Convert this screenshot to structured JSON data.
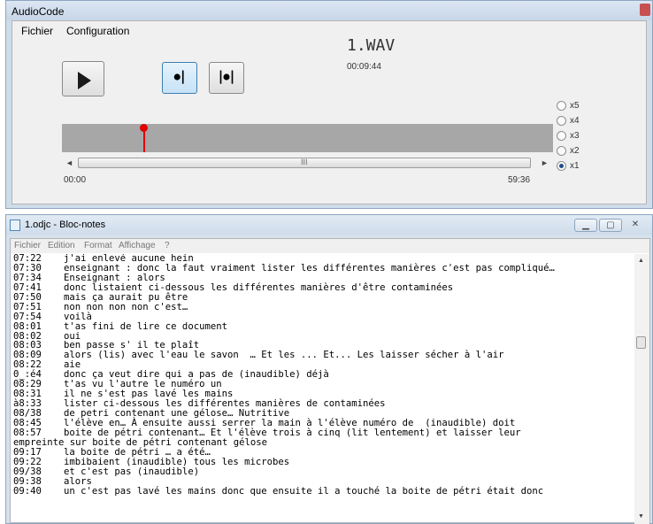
{
  "audio_app": {
    "title": "AudioCode",
    "menu": [
      "Fichier",
      "Configuration"
    ],
    "buttons": {
      "play_icon": "play-icon",
      "rewind_icon": "backstep-icon",
      "forward_icon": "forward-step-icon"
    },
    "filename": "1.WAV",
    "elapsed": "00:09:44",
    "timeline": {
      "start": "00:00",
      "end": "59:36",
      "position_fraction": 0.166,
      "marker_color": "#e00000"
    },
    "scroll_grip": "III",
    "speeds": [
      {
        "label": "x5",
        "selected": false
      },
      {
        "label": "x4",
        "selected": false
      },
      {
        "label": "x3",
        "selected": false
      },
      {
        "label": "x2",
        "selected": false
      },
      {
        "label": "x1",
        "selected": true
      }
    ]
  },
  "notepad": {
    "title": "1.odjc - Bloc-notes",
    "menu": [
      "Fichier",
      "Edition",
      "Format",
      "Affichage",
      "?"
    ],
    "lines": [
      {
        "ts": "07:22",
        "text": "j'ai enlevé aucune hein"
      },
      {
        "ts": "07:30",
        "text": "enseignant : donc la faut vraiment lister les différentes manières c'est pas compliqué…"
      },
      {
        "ts": "07:34",
        "text": "Enseignant : alors"
      },
      {
        "ts": "07:41",
        "text": "donc listaient ci-dessous les différentes manières d'être contaminées"
      },
      {
        "ts": "07:50",
        "text": "mais ça aurait pu être"
      },
      {
        "ts": "07:51",
        "text": "non non non non c'est…"
      },
      {
        "ts": "07:54",
        "text": "voilà"
      },
      {
        "ts": "08:01",
        "text": "t'as fini de lire ce document"
      },
      {
        "ts": "08:02",
        "text": "oui"
      },
      {
        "ts": "08:03",
        "text": "ben passe s' il te plaît"
      },
      {
        "ts": "08:09",
        "text": "alors (lis) avec l'eau le savon  … Et les ... Et... Les laisser sécher à l'air"
      },
      {
        "ts": "08:22",
        "text": "aie"
      },
      {
        "ts": "0_:é4",
        "text": "donc ça veut dire qui a pas de (inaudible) déjà"
      },
      {
        "ts": "08:29",
        "text": "t'as vu l'autre le numéro un"
      },
      {
        "ts": "08:31",
        "text": "il ne s'est pas lavé les mains"
      },
      {
        "ts": "à8:33",
        "text": "lister ci-dessous les différentes manières de contaminées"
      },
      {
        "ts": "08/38",
        "text": "de petri contenant une gélose… Nutritive"
      },
      {
        "ts": "08:45",
        "text": "l'élève en… À ensuite aussi serrer la main à l'élève numéro de  (inaudible) doit"
      },
      {
        "ts": "08:57",
        "text": "boite de pétri contenant… Et l'élève trois à cinq (lit lentement) et laisser leur"
      },
      {
        "ts": "",
        "text": "empreinte sur boite de pétri contenant gélose"
      },
      {
        "ts": "09:17",
        "text": "la boite de pétri … a été…"
      },
      {
        "ts": "09:22",
        "text": "imbibaient (inaudible) tous les microbes"
      },
      {
        "ts": "09/38",
        "text": "et c'est pas (inaudible)"
      },
      {
        "ts": "09:38",
        "text": "alors"
      },
      {
        "ts": "09:40",
        "text": "un c'est pas lavé les mains donc que ensuite il a touché la boite de pétri était donc"
      }
    ]
  }
}
